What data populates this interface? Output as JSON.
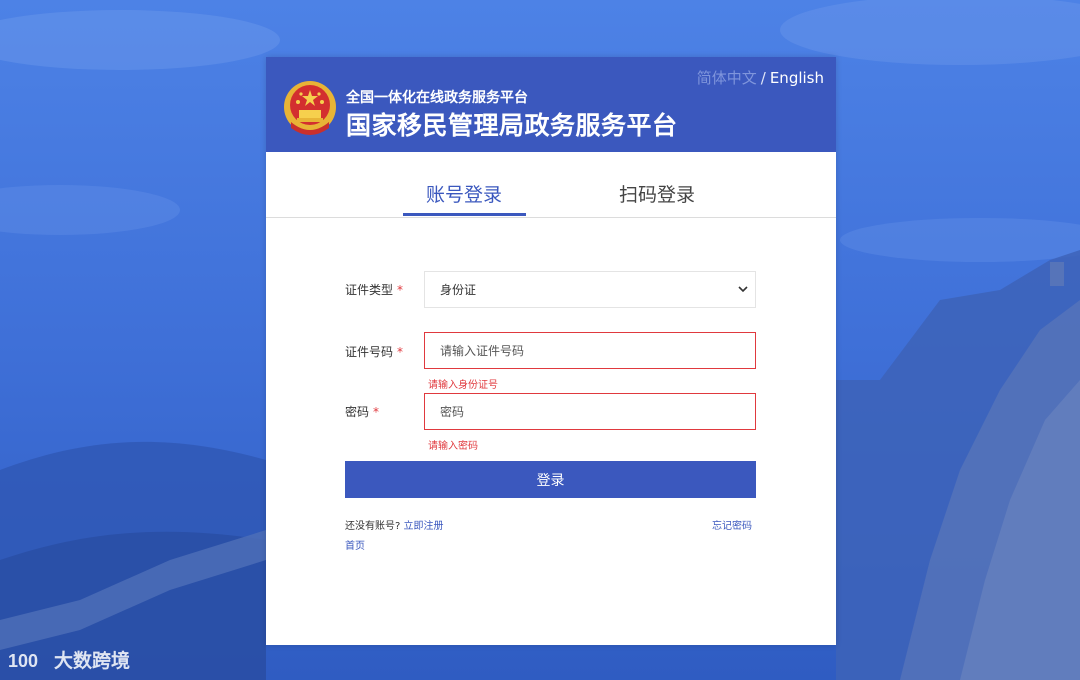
{
  "header": {
    "subtitle": "全国一体化在线政务服务平台",
    "title": "国家移民管理局政务服务平台",
    "lang_zh": "简体中文",
    "lang_sep": "/",
    "lang_en": "English"
  },
  "tabs": [
    {
      "label": "账号登录",
      "active": true
    },
    {
      "label": "扫码登录",
      "active": false
    }
  ],
  "form": {
    "id_type": {
      "label": "证件类型",
      "required_mark": "*",
      "value": "身份证",
      "options": [
        "身份证"
      ]
    },
    "id_number": {
      "label": "证件号码",
      "required_mark": "*",
      "value": "",
      "placeholder": "请输入证件号码",
      "error": "请输入身份证号"
    },
    "password": {
      "label": "密码",
      "required_mark": "*",
      "value": "",
      "placeholder": "密码",
      "error": "请输入密码"
    },
    "login_label": "登录"
  },
  "footer_links": {
    "no_account": "还没有账号?",
    "register": "立即注册",
    "forgot": "忘记密码",
    "home": "首页"
  },
  "watermark": {
    "logo_text": "100",
    "text": "大数跨境"
  },
  "colors": {
    "primary": "#3b58be",
    "error": "#e0393e",
    "background": "#3d6fd6"
  }
}
